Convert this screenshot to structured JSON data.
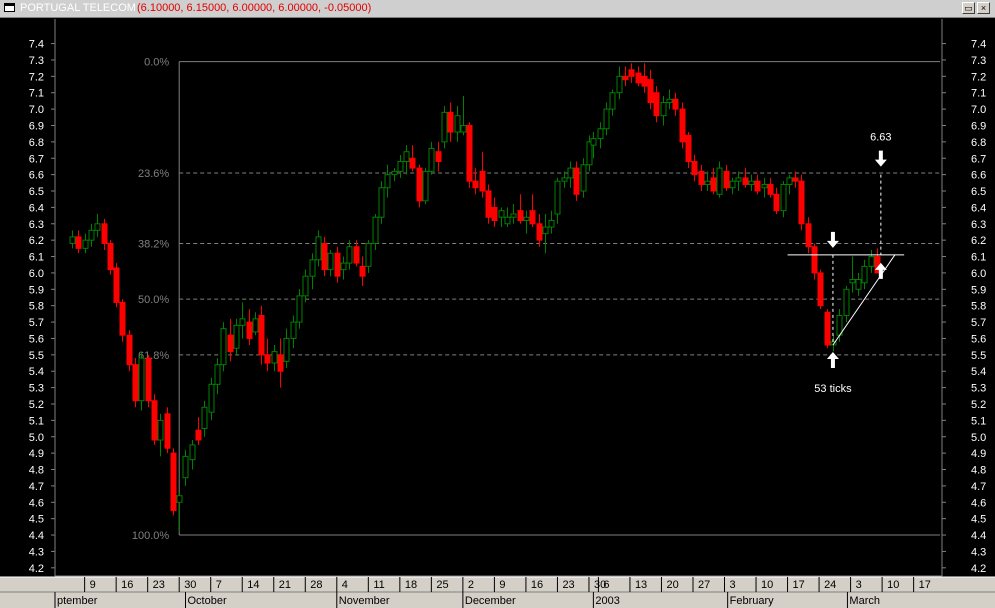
{
  "window": {
    "title": "PORTUGAL TELECOM",
    "values": "(6.10000, 6.15000, 6.00000, 6.00000, -0.05000)",
    "restore_icon": "restore-icon",
    "close_icon": "close-icon"
  },
  "chart_data": {
    "type": "candlestick",
    "title": "PORTUGAL TELECOM",
    "ylim": [
      4.15,
      7.55
    ],
    "y_ticks": [
      4.2,
      4.3,
      4.4,
      4.5,
      4.6,
      4.7,
      4.8,
      4.9,
      5.0,
      5.1,
      5.2,
      5.3,
      5.4,
      5.5,
      5.6,
      5.7,
      5.8,
      5.9,
      6.0,
      6.1,
      6.2,
      6.3,
      6.4,
      6.5,
      6.6,
      6.7,
      6.8,
      6.9,
      7.0,
      7.1,
      7.2,
      7.3,
      7.4
    ],
    "y_tick_labels": [
      "4.2",
      "4.3",
      "4.4",
      "4.5",
      "4.6",
      "4.7",
      "4.8",
      "4.9",
      "5.0",
      "5.1",
      "5.2",
      "5.3",
      "5.4",
      "5.5",
      "5.6",
      "5.7",
      "5.8",
      "5.9",
      "6.0",
      "6.1",
      "6.2",
      "6.3",
      "6.4",
      "6.5",
      "6.6",
      "6.7",
      "6.8",
      "6.9",
      "7.0",
      "7.1",
      "7.2",
      "7.3",
      "7.4"
    ],
    "x_week_ticks": [
      {
        "day": 2,
        "label": "9"
      },
      {
        "day": 7,
        "label": "16"
      },
      {
        "day": 12,
        "label": "23"
      },
      {
        "day": 17,
        "label": "30"
      },
      {
        "day": 22,
        "label": "7"
      },
      {
        "day": 27,
        "label": "14"
      },
      {
        "day": 32,
        "label": "21"
      },
      {
        "day": 37,
        "label": "28"
      },
      {
        "day": 42,
        "label": "4"
      },
      {
        "day": 47,
        "label": "11"
      },
      {
        "day": 52,
        "label": "18"
      },
      {
        "day": 57,
        "label": "25"
      },
      {
        "day": 62,
        "label": "2"
      },
      {
        "day": 67,
        "label": "9"
      },
      {
        "day": 72,
        "label": "16"
      },
      {
        "day": 77,
        "label": "23"
      },
      {
        "day": 82,
        "label": "30"
      },
      {
        "day": 83.5,
        "label": "6"
      },
      {
        "day": 88.5,
        "label": "13"
      },
      {
        "day": 93.5,
        "label": "20"
      },
      {
        "day": 98.5,
        "label": "27"
      },
      {
        "day": 103.5,
        "label": "3"
      },
      {
        "day": 108.5,
        "label": "10"
      },
      {
        "day": 113.5,
        "label": "17"
      },
      {
        "day": 118.5,
        "label": "24"
      },
      {
        "day": 123.5,
        "label": "3"
      },
      {
        "day": 128.5,
        "label": "10"
      },
      {
        "day": 133.5,
        "label": "17"
      }
    ],
    "x_months": [
      {
        "day": 0,
        "label": "ptember"
      },
      {
        "day": 18,
        "label": "October"
      },
      {
        "day": 42,
        "label": "November"
      },
      {
        "day": 62,
        "label": "December"
      },
      {
        "day": 82.7,
        "label": "2003"
      },
      {
        "day": 104,
        "label": "February"
      },
      {
        "day": 123,
        "label": "March"
      }
    ],
    "x_range_days": [
      -2.7,
      138
    ],
    "candles": [
      [
        0,
        6.18,
        6.26,
        6.15,
        6.22
      ],
      [
        1,
        6.22,
        6.26,
        6.12,
        6.15
      ],
      [
        2,
        6.15,
        6.24,
        6.12,
        6.2
      ],
      [
        3,
        6.2,
        6.3,
        6.16,
        6.26
      ],
      [
        4,
        6.26,
        6.36,
        6.22,
        6.3
      ],
      [
        5,
        6.3,
        6.33,
        6.14,
        6.18
      ],
      [
        6,
        6.18,
        6.2,
        5.99,
        6.02
      ],
      [
        7,
        6.03,
        6.06,
        5.79,
        5.82
      ],
      [
        8,
        5.82,
        5.84,
        5.58,
        5.62
      ],
      [
        9,
        5.62,
        5.65,
        5.4,
        5.44
      ],
      [
        10,
        5.44,
        5.48,
        5.18,
        5.22
      ],
      [
        11,
        5.22,
        5.52,
        5.16,
        5.48
      ],
      [
        12,
        5.48,
        5.5,
        5.18,
        5.22
      ],
      [
        13,
        5.22,
        5.26,
        4.95,
        4.98
      ],
      [
        14,
        4.98,
        5.14,
        4.88,
        5.1
      ],
      [
        15,
        5.14,
        5.18,
        4.9,
        4.93
      ],
      [
        16,
        4.9,
        4.93,
        4.52,
        4.55
      ],
      [
        17,
        4.6,
        4.66,
        4.42,
        4.64
      ],
      [
        18,
        4.75,
        4.92,
        4.7,
        4.88
      ],
      [
        19,
        4.86,
        4.98,
        4.8,
        4.95
      ],
      [
        20,
        5.04,
        5.12,
        4.95,
        4.98
      ],
      [
        21,
        5.05,
        5.22,
        5.0,
        5.18
      ],
      [
        22,
        5.15,
        5.36,
        5.1,
        5.32
      ],
      [
        23,
        5.32,
        5.48,
        5.26,
        5.44
      ],
      [
        24,
        5.44,
        5.7,
        5.4,
        5.66
      ],
      [
        25,
        5.62,
        5.72,
        5.46,
        5.52
      ],
      [
        26,
        5.54,
        5.72,
        5.5,
        5.68
      ],
      [
        27,
        5.68,
        5.82,
        5.6,
        5.72
      ],
      [
        28,
        5.7,
        5.78,
        5.56,
        5.6
      ],
      [
        29,
        5.64,
        5.76,
        5.62,
        5.72
      ],
      [
        30,
        5.74,
        5.8,
        5.44,
        5.5
      ],
      [
        31,
        5.5,
        5.6,
        5.4,
        5.45
      ],
      [
        32,
        5.45,
        5.56,
        5.4,
        5.52
      ],
      [
        33,
        5.5,
        5.6,
        5.3,
        5.4
      ],
      [
        34,
        5.46,
        5.66,
        5.42,
        5.6
      ],
      [
        35,
        5.6,
        5.74,
        5.54,
        5.7
      ],
      [
        36,
        5.7,
        5.9,
        5.66,
        5.86
      ],
      [
        37,
        5.86,
        6.02,
        5.82,
        5.98
      ],
      [
        38,
        5.98,
        6.12,
        5.9,
        6.08
      ],
      [
        39,
        6.08,
        6.26,
        6.04,
        6.22
      ],
      [
        40,
        6.18,
        6.22,
        5.98,
        6.02
      ],
      [
        41,
        6.02,
        6.14,
        5.98,
        6.12
      ],
      [
        42,
        6.12,
        6.16,
        5.94,
        5.98
      ],
      [
        43,
        6.02,
        6.1,
        5.96,
        6.06
      ],
      [
        44,
        6.06,
        6.2,
        6.02,
        6.16
      ],
      [
        45,
        6.16,
        6.2,
        6.04,
        6.06
      ],
      [
        46,
        6.04,
        6.1,
        5.92,
        5.98
      ],
      [
        47,
        6.04,
        6.2,
        6.0,
        6.18
      ],
      [
        48,
        6.18,
        6.36,
        6.14,
        6.34
      ],
      [
        49,
        6.34,
        6.56,
        6.3,
        6.52
      ],
      [
        50,
        6.52,
        6.66,
        6.46,
        6.6
      ],
      [
        51,
        6.6,
        6.64,
        6.56,
        6.62
      ],
      [
        52,
        6.62,
        6.72,
        6.58,
        6.68
      ],
      [
        53,
        6.68,
        6.78,
        6.6,
        6.74
      ],
      [
        54,
        6.7,
        6.78,
        6.62,
        6.64
      ],
      [
        55,
        6.64,
        6.66,
        6.4,
        6.44
      ],
      [
        56,
        6.44,
        6.64,
        6.42,
        6.62
      ],
      [
        57,
        6.62,
        6.8,
        6.6,
        6.76
      ],
      [
        58,
        6.74,
        6.8,
        6.62,
        6.68
      ],
      [
        59,
        6.8,
        7.02,
        6.76,
        6.98
      ],
      [
        60,
        6.98,
        7.04,
        6.8,
        6.86
      ],
      [
        61,
        6.86,
        7.02,
        6.8,
        6.96
      ],
      [
        62,
        6.86,
        7.08,
        6.84,
        6.9
      ],
      [
        63,
        6.9,
        6.92,
        6.52,
        6.56
      ],
      [
        64,
        6.56,
        6.64,
        6.48,
        6.52
      ],
      [
        65,
        6.62,
        6.74,
        6.46,
        6.5
      ],
      [
        66,
        6.5,
        6.54,
        6.3,
        6.34
      ],
      [
        67,
        6.4,
        6.46,
        6.28,
        6.32
      ],
      [
        68,
        6.34,
        6.4,
        6.28,
        6.38
      ],
      [
        69,
        6.3,
        6.4,
        6.28,
        6.34
      ],
      [
        70,
        6.34,
        6.42,
        6.3,
        6.36
      ],
      [
        71,
        6.38,
        6.48,
        6.3,
        6.32
      ],
      [
        72,
        6.32,
        6.38,
        6.24,
        6.34
      ],
      [
        73,
        6.38,
        6.48,
        6.28,
        6.3
      ],
      [
        74,
        6.3,
        6.36,
        6.16,
        6.2
      ],
      [
        75,
        6.24,
        6.36,
        6.12,
        6.28
      ],
      [
        76,
        6.28,
        6.38,
        6.24,
        6.32
      ],
      [
        77,
        6.36,
        6.58,
        6.3,
        6.56
      ],
      [
        78,
        6.56,
        6.62,
        6.52,
        6.58
      ],
      [
        79,
        6.58,
        6.68,
        6.52,
        6.64
      ],
      [
        80,
        6.64,
        6.68,
        6.44,
        6.48
      ],
      [
        81,
        6.5,
        6.7,
        6.46,
        6.66
      ],
      [
        82,
        6.66,
        6.84,
        6.62,
        6.8
      ],
      [
        82.7,
        6.78,
        6.86,
        6.7,
        6.82
      ],
      [
        83.7,
        6.82,
        6.92,
        6.76,
        6.88
      ],
      [
        84.7,
        6.88,
        7.04,
        6.84,
        7.0
      ],
      [
        85.7,
        7.0,
        7.12,
        6.96,
        7.1
      ],
      [
        86.7,
        7.1,
        7.26,
        7.06,
        7.2
      ],
      [
        87.7,
        7.2,
        7.26,
        7.14,
        7.18
      ],
      [
        88.7,
        7.24,
        7.28,
        7.16,
        7.2
      ],
      [
        89.7,
        7.22,
        7.26,
        7.14,
        7.16
      ],
      [
        90.7,
        7.2,
        7.28,
        7.1,
        7.14
      ],
      [
        91.7,
        7.18,
        7.24,
        7.0,
        7.04
      ],
      [
        92.7,
        7.1,
        7.14,
        6.92,
        6.96
      ],
      [
        93.7,
        6.96,
        7.08,
        6.9,
        7.04
      ],
      [
        94.7,
        7.04,
        7.12,
        7.0,
        7.06
      ],
      [
        95.7,
        7.06,
        7.1,
        6.96,
        7.0
      ],
      [
        96.7,
        7.0,
        7.04,
        6.76,
        6.8
      ],
      [
        97.7,
        6.84,
        6.86,
        6.64,
        6.68
      ],
      [
        98.7,
        6.68,
        6.72,
        6.56,
        6.6
      ],
      [
        99.7,
        6.62,
        6.66,
        6.5,
        6.54
      ],
      [
        100.7,
        6.54,
        6.62,
        6.5,
        6.56
      ],
      [
        101.7,
        6.58,
        6.64,
        6.48,
        6.5
      ],
      [
        102.7,
        6.48,
        6.68,
        6.46,
        6.64
      ],
      [
        103.7,
        6.62,
        6.66,
        6.5,
        6.52
      ],
      [
        104.7,
        6.52,
        6.58,
        6.48,
        6.56
      ],
      [
        105.7,
        6.56,
        6.62,
        6.5,
        6.58
      ],
      [
        106.7,
        6.58,
        6.64,
        6.52,
        6.54
      ],
      [
        107.7,
        6.54,
        6.6,
        6.5,
        6.56
      ],
      [
        108.7,
        6.56,
        6.6,
        6.48,
        6.5
      ],
      [
        109.7,
        6.52,
        6.58,
        6.46,
        6.54
      ],
      [
        110.7,
        6.54,
        6.58,
        6.46,
        6.48
      ],
      [
        111.7,
        6.48,
        6.52,
        6.36,
        6.38
      ],
      [
        112.7,
        6.38,
        6.56,
        6.34,
        6.54
      ],
      [
        113.7,
        6.54,
        6.6,
        6.48,
        6.58
      ],
      [
        114.7,
        6.58,
        6.62,
        6.52,
        6.56
      ],
      [
        115.7,
        6.56,
        6.6,
        6.26,
        6.3
      ],
      [
        116.7,
        6.3,
        6.34,
        6.12,
        6.16
      ],
      [
        117.7,
        6.16,
        6.18,
        5.96,
        6.0
      ],
      [
        118.7,
        6.0,
        6.02,
        5.78,
        5.8
      ],
      [
        119.7,
        5.76,
        5.78,
        5.54,
        5.56
      ],
      [
        120.7,
        5.56,
        5.62,
        5.52,
        5.58
      ],
      [
        121.7,
        5.62,
        5.78,
        5.58,
        5.74
      ],
      [
        122.7,
        5.74,
        5.92,
        5.7,
        5.9
      ],
      [
        123.7,
        5.94,
        6.1,
        5.88,
        5.96
      ],
      [
        124.7,
        5.9,
        6.0,
        5.86,
        5.96
      ],
      [
        125.7,
        5.94,
        6.08,
        5.9,
        6.04
      ],
      [
        126.7,
        6.04,
        6.14,
        6.0,
        6.1
      ],
      [
        127.7,
        6.1,
        6.15,
        6.0,
        6.0
      ]
    ],
    "fib_levels": [
      {
        "label": "0.0%",
        "value": 7.29
      },
      {
        "label": "23.6%",
        "value": 6.61
      },
      {
        "label": "38.2%",
        "value": 6.18
      },
      {
        "label": "50.0%",
        "value": 5.84
      },
      {
        "label": "61.8%",
        "value": 5.5
      },
      {
        "label": "100.0%",
        "value": 4.4
      }
    ],
    "fib_start_day": 17,
    "annotations": {
      "target_label": "6.63",
      "ticks_label": "53 ticks",
      "neckline_value": 6.11,
      "neckline_days": [
        113.5,
        132
      ],
      "target_value": 6.6,
      "measure_day": 120.7,
      "target_day": 128.3,
      "low_value": 5.56,
      "arrow_color": "#ffffff"
    },
    "colors": {
      "background": "#000000",
      "up_candle": "#008000",
      "down_candle": "#ff0000",
      "grid": "#808080",
      "text": "#ffffff"
    }
  }
}
